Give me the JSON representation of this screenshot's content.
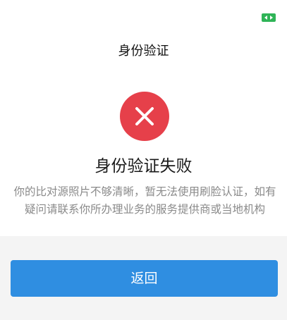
{
  "header": {
    "title": "身份验证",
    "corner_icon": "battery-icon"
  },
  "result": {
    "icon": "close-icon",
    "title": "身份验证失败",
    "message": "你的比对源照片不够清晰，暂无法使用刷脸认证，如有疑问请联系你所办理业务的服务提供商或当地机构"
  },
  "actions": {
    "back_label": "返回"
  },
  "colors": {
    "error": "#e6404a",
    "primary": "#2f8ee1",
    "badge": "#2fb457"
  }
}
